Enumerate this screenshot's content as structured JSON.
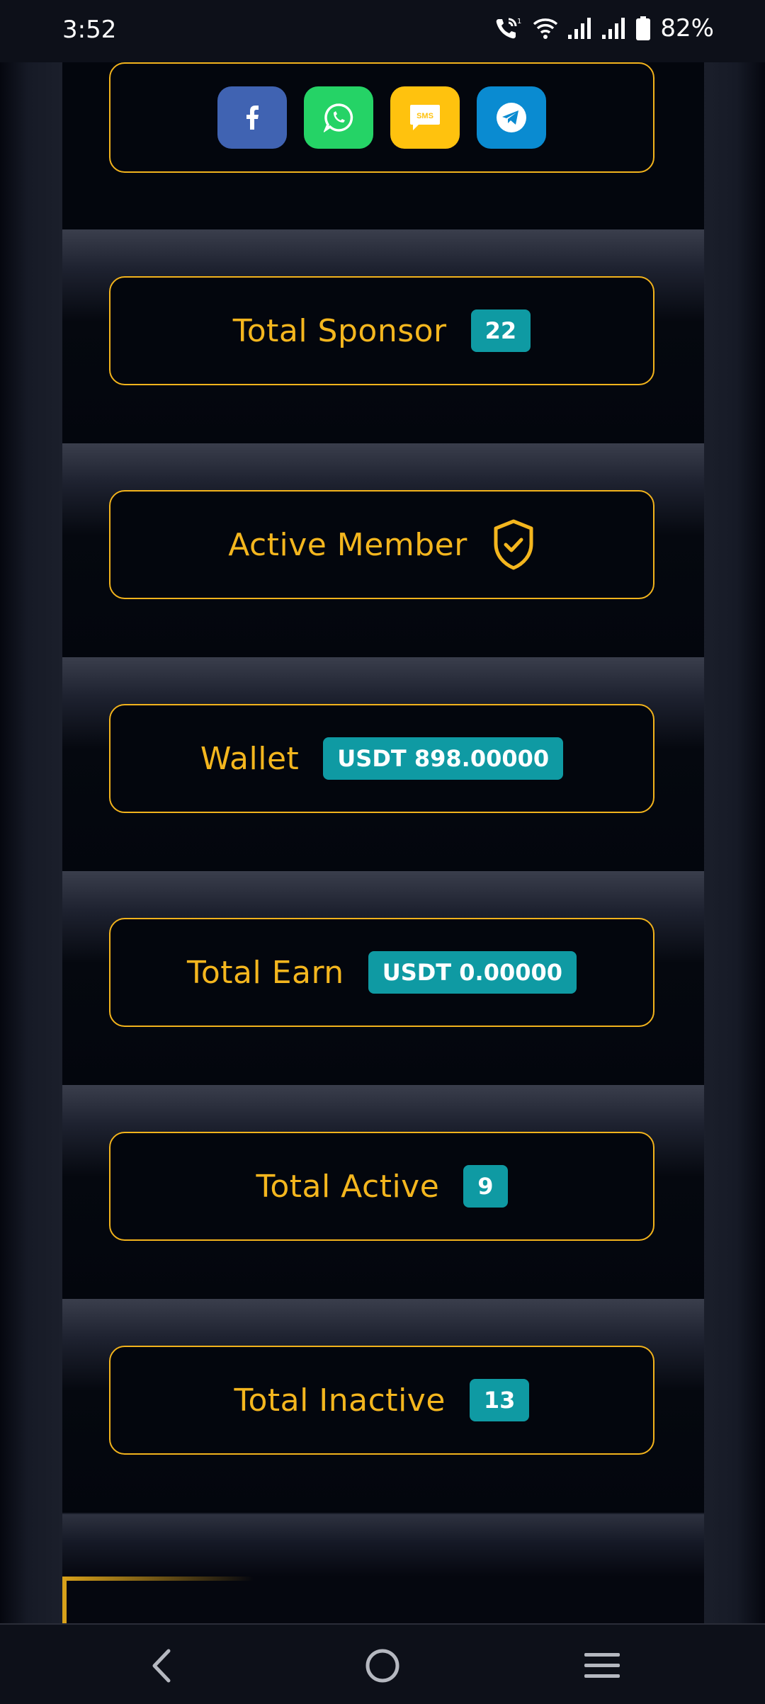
{
  "status_bar": {
    "time": "3:52",
    "battery": "82%"
  },
  "cards": [
    {
      "label": "Total Sponsor",
      "value": "22"
    },
    {
      "label": "Active Member",
      "icon": "shield-check-icon"
    },
    {
      "label": "Wallet",
      "value": "USDT 898.00000"
    },
    {
      "label": "Total Earn",
      "value": "USDT 0.00000"
    },
    {
      "label": "Total Active",
      "value": "9"
    },
    {
      "label": "Total Inactive",
      "value": "13"
    }
  ],
  "share_buttons": [
    {
      "name": "facebook",
      "icon": "facebook-icon",
      "color": "#4063b2"
    },
    {
      "name": "whatsapp",
      "icon": "whatsapp-icon",
      "color": "#25d366"
    },
    {
      "name": "sms",
      "icon": "sms-icon",
      "label": "SMS",
      "color": "#ffc20e"
    },
    {
      "name": "telegram",
      "icon": "telegram-icon",
      "color": "#0a8bd1"
    }
  ],
  "colors": {
    "accent": "#f4b61e",
    "badge": "#0f9aa3",
    "background": "#03060d"
  }
}
